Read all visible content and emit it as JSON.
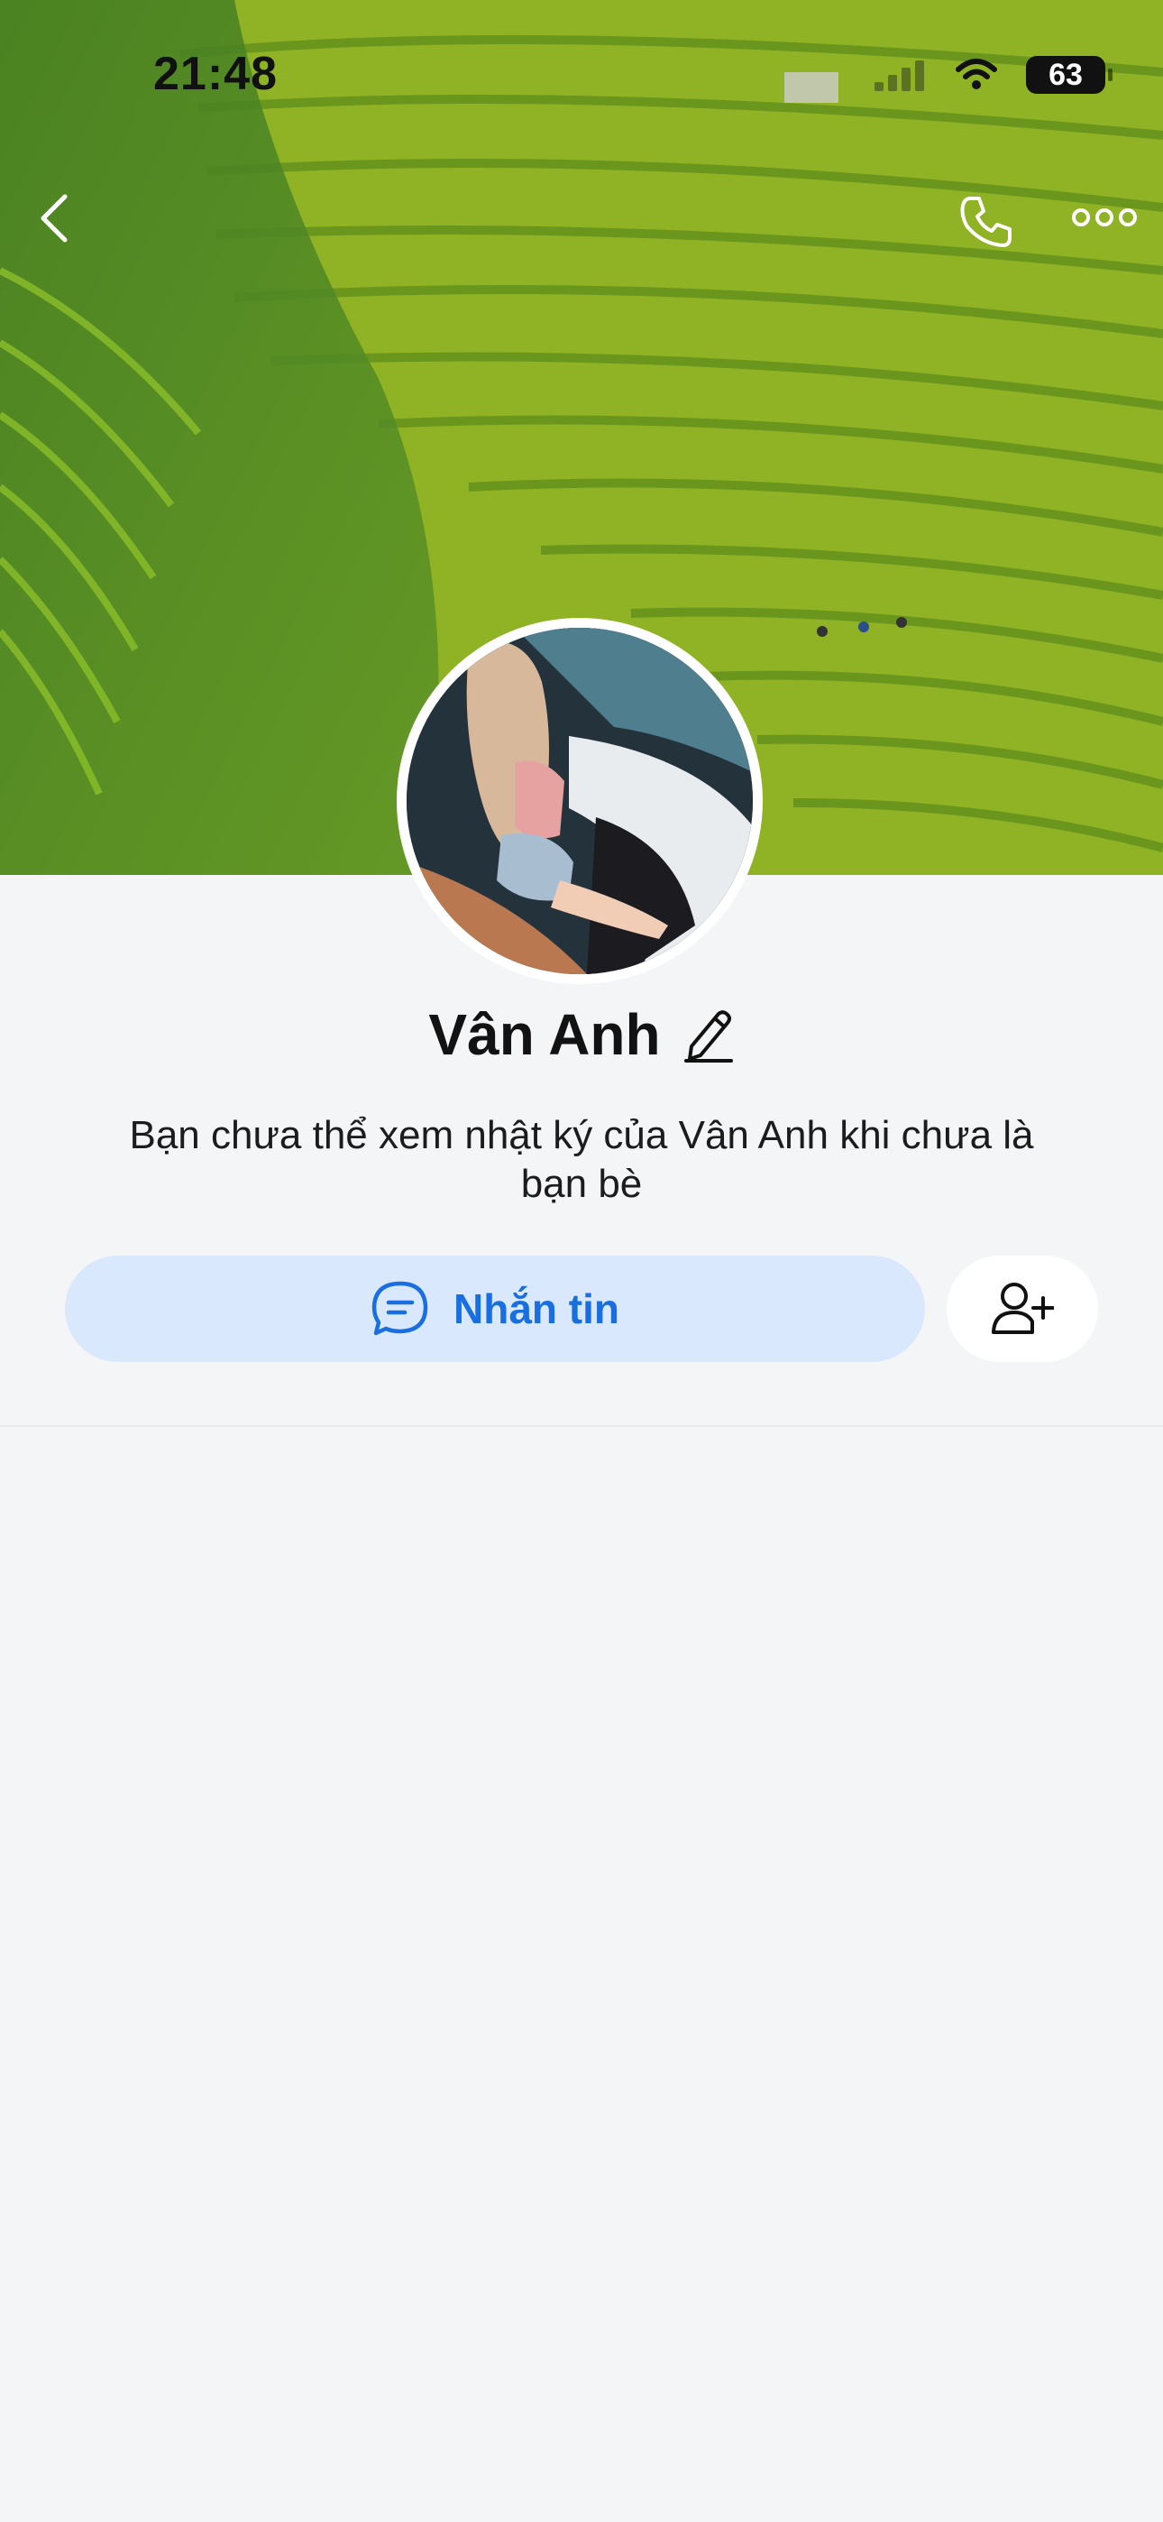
{
  "status_bar": {
    "time": "21:48",
    "battery": "63"
  },
  "profile": {
    "name": "Vân Anh",
    "notice": "Bạn chưa thể xem nhật ký của Vân Anh khi chưa là bạn bè"
  },
  "actions": {
    "message_label": "Nhắn tin"
  },
  "icons": {
    "back": "chevron-left-icon",
    "call": "phone-icon",
    "more": "more-horizontal-icon",
    "edit": "pencil-icon",
    "message": "chat-bubble-icon",
    "add_friend": "user-plus-icon"
  },
  "colors": {
    "accent": "#1a6fe0",
    "message_button_bg": "#d9e8fc",
    "page_bg": "#f4f5f7"
  }
}
